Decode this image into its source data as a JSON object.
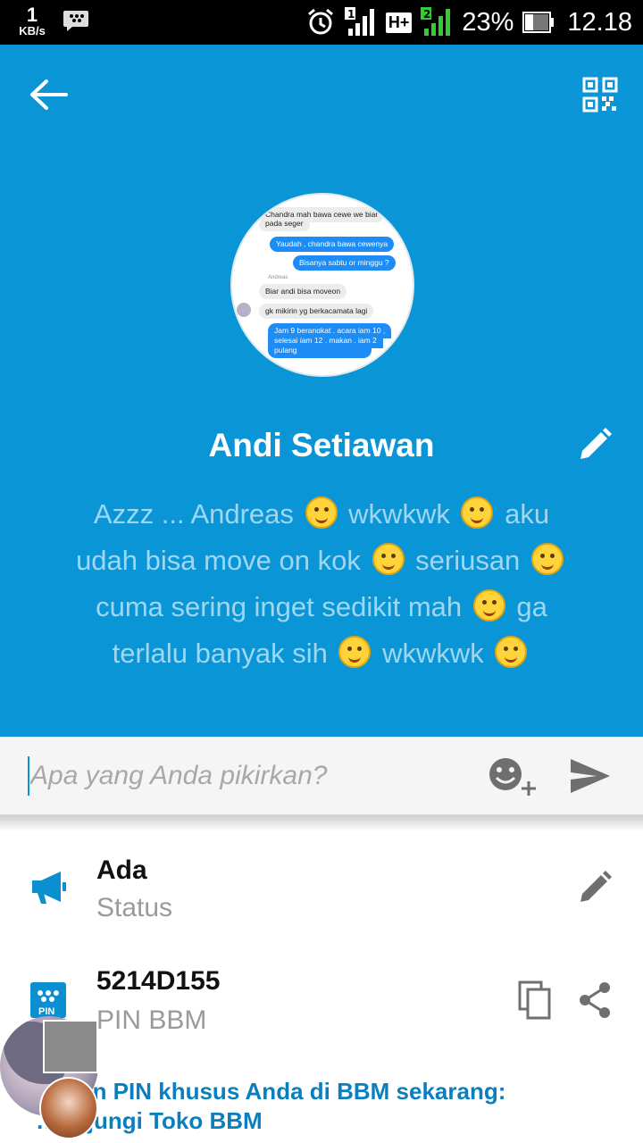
{
  "statusbar": {
    "net_speed_value": "1",
    "net_speed_unit": "KB/s",
    "sim_badge": "1",
    "network_type": "H+",
    "sim2_badge": "2",
    "battery_percent": "23%",
    "time": "12.18"
  },
  "profile": {
    "name": "Andi Setiawan",
    "status_parts": [
      "Azzz ... Andreas",
      "wkwkwk",
      "aku udah bisa move on kok",
      "seriusan",
      "cuma sering inget sedikit mah",
      "ga terlalu banyak sih",
      "wkwkwk"
    ],
    "emoji_icons": [
      "pleading-face",
      "yum-face",
      "grin-face",
      "smile-face",
      "laughing-face",
      "rofl-face",
      "yum-face"
    ]
  },
  "avatar_chat": {
    "messages": [
      {
        "dir": "in",
        "text": "Chandra mah bawa cewe we biar"
      },
      {
        "dir": "in",
        "text": "pada seger"
      },
      {
        "dir": "out",
        "text": "Yaudah , chandra bawa cewenya"
      },
      {
        "dir": "out",
        "text": "Bisanya sabtu or minggu ?"
      },
      {
        "dir": "sender",
        "text": "Andreas"
      },
      {
        "dir": "in",
        "text": "Biar andi bisa moveon"
      },
      {
        "dir": "in",
        "text": "gk mikirin yg berkacamata lagi"
      },
      {
        "dir": "out",
        "text": "Jam 9 berangkat , acara jam 10 ,"
      },
      {
        "dir": "out",
        "text": "selesai jam 12 , makan , jam 2"
      },
      {
        "dir": "out",
        "text": "pulang"
      }
    ]
  },
  "composer": {
    "placeholder": "Apa yang Anda pikirkan?"
  },
  "rows": {
    "status": {
      "title": "Ada",
      "subtitle": "Status"
    },
    "pin": {
      "title": "5214D155",
      "subtitle": "PIN BBM",
      "icon_label": "PIN"
    }
  },
  "promo": {
    "line1": "…tkan PIN khusus Anda di BBM sekarang:",
    "line2": "…unjungi Toko BBM"
  },
  "colors": {
    "header_bg": "#0a96d6",
    "accent": "#0a96d6",
    "status_text": "#9fd6f2",
    "icon_blue": "#0a8fd0",
    "icon_gray": "#6f6f6f"
  }
}
